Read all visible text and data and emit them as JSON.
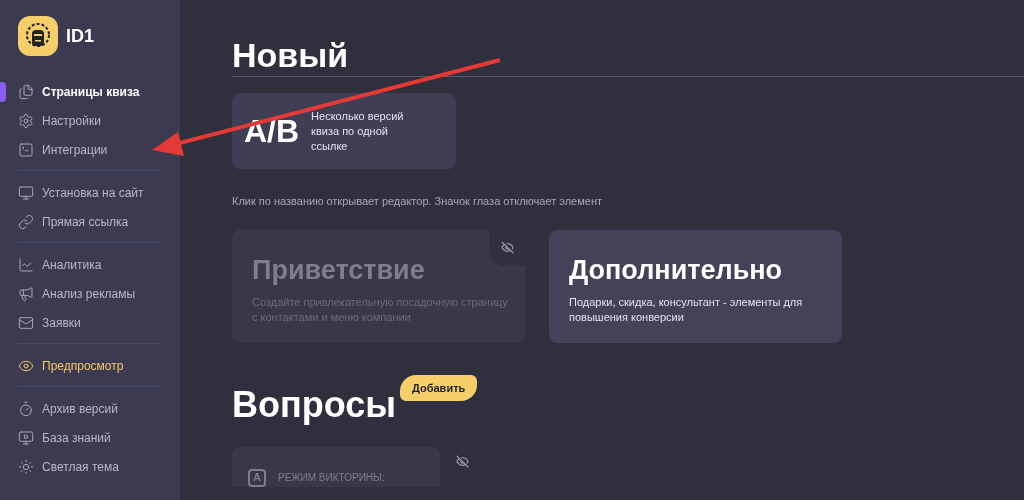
{
  "logo": {
    "text": "ID1"
  },
  "sidebar": {
    "groups": [
      {
        "items": [
          {
            "label": "Страницы квиза",
            "selected": true,
            "kind": "nav"
          },
          {
            "label": "Настройки",
            "selected": false,
            "kind": "nav"
          },
          {
            "label": "Интеграции",
            "selected": false,
            "kind": "nav"
          }
        ]
      },
      {
        "items": [
          {
            "label": "Установка на сайт",
            "selected": false,
            "kind": "nav"
          },
          {
            "label": "Прямая ссылка",
            "selected": false,
            "kind": "nav"
          }
        ]
      },
      {
        "items": [
          {
            "label": "Аналитика",
            "selected": false,
            "kind": "nav"
          },
          {
            "label": "Анализ рекламы",
            "selected": false,
            "kind": "nav"
          },
          {
            "label": "Заявки",
            "selected": false,
            "kind": "nav"
          }
        ]
      },
      {
        "items": [
          {
            "label": "Предпросмотр",
            "selected": false,
            "kind": "accent"
          }
        ]
      },
      {
        "items": [
          {
            "label": "Архив версий",
            "selected": false,
            "kind": "nav"
          },
          {
            "label": "База знаний",
            "selected": false,
            "kind": "nav"
          },
          {
            "label": "Светлая тема",
            "selected": false,
            "kind": "nav"
          }
        ]
      }
    ]
  },
  "new_section": {
    "title": "Новый",
    "ab_card": {
      "badge": "A/B",
      "text": "Несколько версий квиза по одной ссылке"
    },
    "hint": "Клик по названию открывает редактор. Значок глаза отключает элемент"
  },
  "cards": [
    {
      "title": "Приветствие",
      "text": "Создайте привлекательную посадочную страницу с контактами и меню компании",
      "hidden": true
    },
    {
      "title": "Дополнительно",
      "text": "Подарки, скидка, консультант - элементы для повышения конверсии",
      "hidden": false
    }
  ],
  "questions": {
    "title": "Вопросы",
    "add_button": "Добавить",
    "items": [
      {
        "icon_letter": "A",
        "label": "РЕЖИМ ВИКТОРИНЫ:",
        "hidden": true
      }
    ]
  }
}
